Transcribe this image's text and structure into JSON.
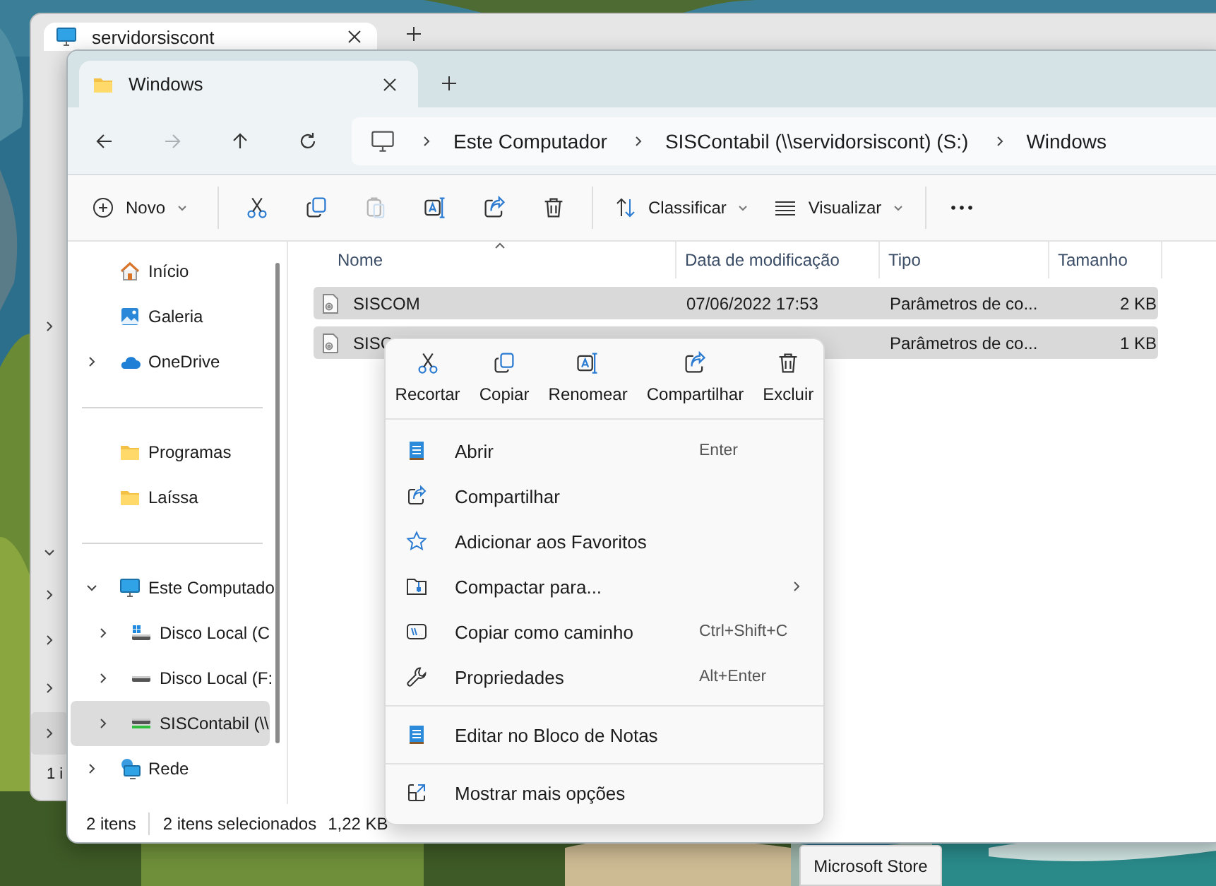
{
  "back_window": {
    "tab": {
      "title": "servidorsiscont",
      "selected": true
    },
    "sidebar_chevrons": [
      {
        "expanded": false
      },
      {
        "expanded": true
      },
      {
        "expanded": false
      },
      {
        "expanded": false
      },
      {
        "expanded": false
      },
      {
        "expanded": false,
        "selected": true
      }
    ],
    "status_text": "1 i"
  },
  "window": {
    "tabs": [
      {
        "title": "Windows",
        "selected": true
      }
    ],
    "nav": [
      {
        "kind": "back",
        "disabled": false
      },
      {
        "kind": "forward",
        "disabled": true
      },
      {
        "kind": "up",
        "disabled": false
      },
      {
        "kind": "refresh",
        "disabled": false
      }
    ],
    "breadcrumb": [
      "Este Computador",
      "SISContabil (\\\\servidorsiscont) (S:)",
      "Windows"
    ],
    "toolbar": {
      "new_label": "Novo",
      "actions": [
        {
          "kind": "cut",
          "disabled": false
        },
        {
          "kind": "copy",
          "disabled": false
        },
        {
          "kind": "paste",
          "disabled": true
        },
        {
          "kind": "rename",
          "disabled": false
        },
        {
          "kind": "share",
          "disabled": false
        },
        {
          "kind": "delete",
          "disabled": false
        }
      ],
      "sort_label": "Classificar",
      "view_label": "Visualizar"
    },
    "sidebar": {
      "groups": [
        [
          {
            "label": "Início",
            "kind": "home",
            "selected": false
          },
          {
            "label": "Galeria",
            "kind": "gallery",
            "selected": false
          },
          {
            "label": "OneDrive",
            "kind": "cloud",
            "expanded": false,
            "selected": false
          }
        ],
        [
          {
            "label": "Programas",
            "kind": "folder",
            "selected": false
          },
          {
            "label": "Laíssa",
            "kind": "folder",
            "selected": false
          }
        ],
        [
          {
            "label": "Este Computado",
            "kind": "pc",
            "expanded": true,
            "selected": false,
            "children": [
              {
                "label": "Disco Local (C",
                "kind": "drive-win",
                "expanded": false,
                "selected": false
              },
              {
                "label": "Disco Local (F:",
                "kind": "drive",
                "expanded": false,
                "selected": false
              },
              {
                "label": "SISContabil (\\\\",
                "kind": "net-drive",
                "expanded": false,
                "selected": true
              }
            ]
          },
          {
            "label": "Rede",
            "kind": "network",
            "expanded": false,
            "selected": false
          }
        ]
      ]
    },
    "table": {
      "columns": [
        {
          "label": "Nome",
          "sorted_ascending": true
        },
        {
          "label": "Data de modificação"
        },
        {
          "label": "Tipo"
        },
        {
          "label": "Tamanho"
        }
      ],
      "rows": [
        {
          "name": "SISCOM",
          "date": "07/06/2022 17:53",
          "type": "Parâmetros de co...",
          "size": "2 KB",
          "selected": true
        },
        {
          "name": "SISC",
          "type": "Parâmetros de co...",
          "size": "1 KB",
          "selected": true
        }
      ]
    },
    "context_menu": {
      "quick_actions": [
        {
          "kind": "cut",
          "label": "Recortar"
        },
        {
          "kind": "copy",
          "label": "Copiar"
        },
        {
          "kind": "rename",
          "label": "Renomear"
        },
        {
          "kind": "share",
          "label": "Compartilhar"
        },
        {
          "kind": "delete",
          "label": "Excluir"
        }
      ],
      "items": [
        {
          "kind": "command",
          "label": "Abrir",
          "shortcut": "Enter",
          "submenu": false
        },
        {
          "kind": "command",
          "label": "Compartilhar",
          "submenu": false
        },
        {
          "kind": "command",
          "label": "Adicionar aos Favoritos",
          "submenu": false
        },
        {
          "kind": "command",
          "label": "Compactar para...",
          "submenu": true
        },
        {
          "kind": "command",
          "label": "Copiar como caminho",
          "shortcut": "Ctrl+Shift+C",
          "submenu": false
        },
        {
          "kind": "command",
          "label": "Propriedades",
          "shortcut": "Alt+Enter",
          "submenu": false
        },
        {
          "kind": "separator"
        },
        {
          "kind": "command",
          "label": "Editar no Bloco de Notas",
          "submenu": false
        },
        {
          "kind": "separator"
        },
        {
          "kind": "command",
          "label": "Mostrar mais opções",
          "submenu": false
        }
      ]
    },
    "status_bar": {
      "item_count": "2 itens",
      "selection": "2 itens selecionados",
      "selection_size": "1,22 KB"
    }
  },
  "tooltip": {
    "text": "Microsoft Store"
  }
}
